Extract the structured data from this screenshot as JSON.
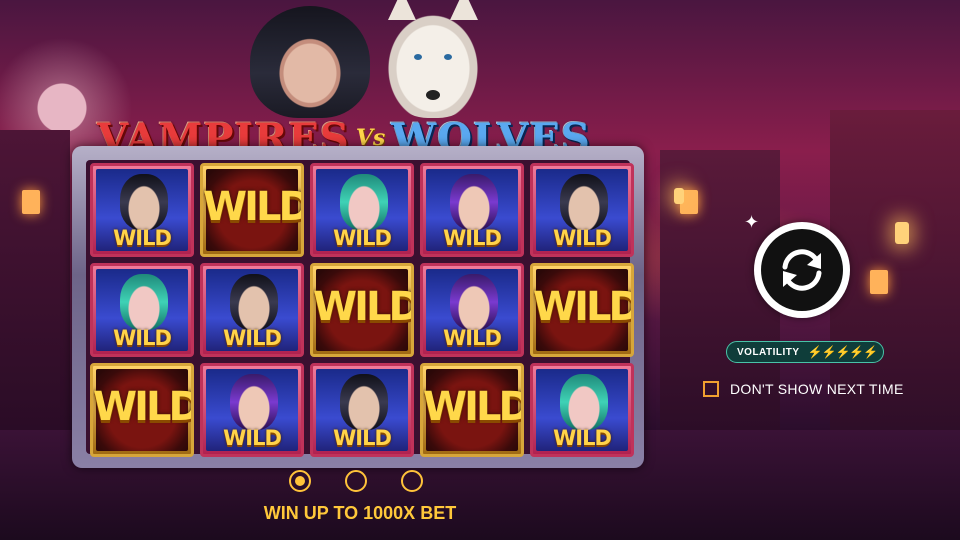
{
  "game": {
    "logo_part1": "VAMPIRES",
    "logo_vs": "Vs",
    "logo_part2": "WOLVES"
  },
  "reels": {
    "columns": 5,
    "rows": 3,
    "symbols": [
      [
        "vampire-dark",
        "wild",
        "vampire-green",
        "vampire-purple",
        "vampire-dark"
      ],
      [
        "vampire-green",
        "vampire-dark",
        "wild",
        "vampire-purple",
        "wild"
      ],
      [
        "wild",
        "vampire-purple",
        "vampire-dark",
        "wild",
        "vampire-green"
      ]
    ],
    "wild_label": "WILD"
  },
  "controls": {
    "spin_icon": "refresh-arrows-icon",
    "volatility_label": "VOLATILITY",
    "volatility_level": 5,
    "volatility_max": 5,
    "volatility_bolts": "⚡⚡⚡⚡⚡",
    "dont_show_label": "DON'T SHOW NEXT TIME",
    "dont_show_checked": false
  },
  "pager": {
    "pages": 3,
    "active": 0,
    "caption": "WIN UP TO 1000X BET"
  },
  "colors": {
    "accent_gold": "#ffc33a",
    "checkbox_orange": "#f0a030",
    "volatility_bg": "#0f3d3a"
  }
}
